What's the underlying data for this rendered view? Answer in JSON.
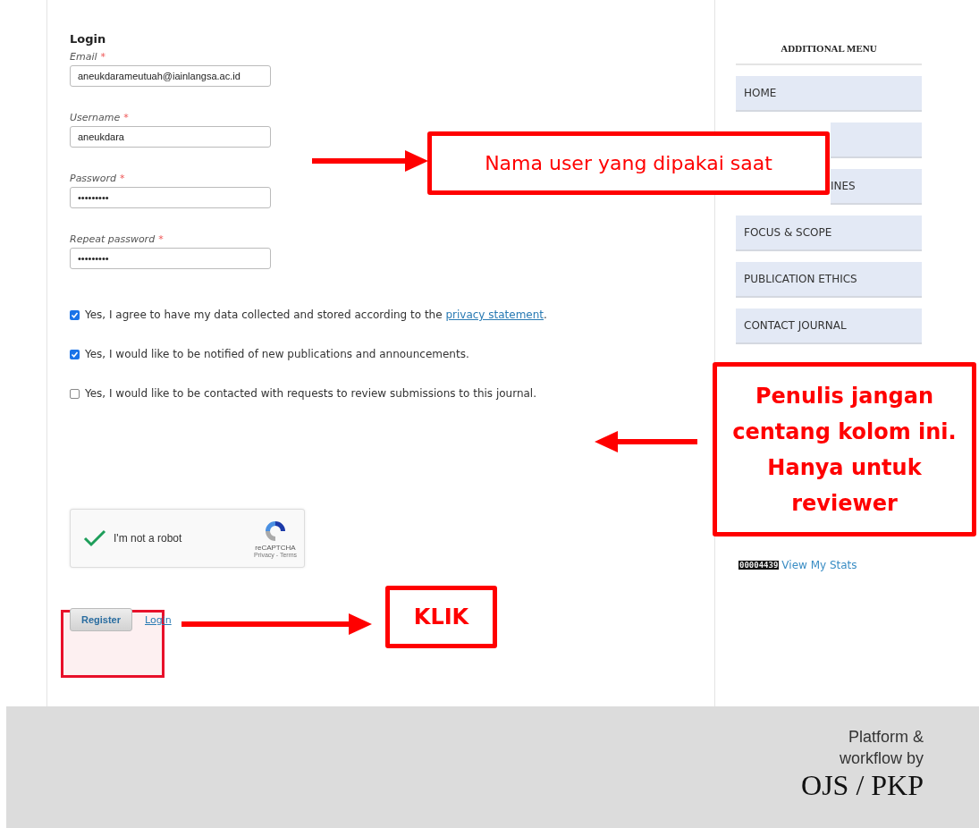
{
  "form": {
    "title": "Login",
    "fields": [
      {
        "label": "Email",
        "mark": "*",
        "value": "aneukdarameutuah@iainlangsa.ac.id"
      },
      {
        "label": "Username",
        "mark": "*",
        "value": "aneukdara"
      },
      {
        "label": "Password",
        "mark": "*",
        "value": "•••••••••"
      },
      {
        "label": "Repeat password",
        "mark": "*",
        "value": "•••••••••"
      }
    ],
    "consents": [
      {
        "text": "Yes, I agree to have my data collected and stored according to the ",
        "link": "privacy statement",
        "after": ".",
        "checked": true
      },
      {
        "text": "Yes, I would like to be notified of new publications and announcements.",
        "checked": true
      },
      {
        "text": "Yes, I would like to be contacted with requests to review submissions to this journal.",
        "checked": false
      }
    ],
    "captcha": {
      "label": "I'm not a robot",
      "checked": true,
      "brand": "reCAPTCHA",
      "links": "Privacy - Terms"
    },
    "register_button": "Register",
    "login_link": "Login"
  },
  "sidebar": {
    "title": "ADDITIONAL MENU",
    "items": [
      {
        "label": "HOME",
        "covered": false
      },
      {
        "covered": true
      },
      {
        "label": "INES",
        "covered": true
      },
      {
        "label": "FOCUS & SCOPE",
        "covered": false
      },
      {
        "label": "PUBLICATION ETHICS",
        "covered": false
      },
      {
        "label": "CONTACT JOURNAL",
        "covered": false
      }
    ],
    "counter": "00004439",
    "stats_link": "View My Stats"
  },
  "footer": {
    "lines": [
      "Platform &",
      "workflow by"
    ],
    "logo": "OJS / PKP"
  },
  "annotations": [
    {
      "kind": "note",
      "lines": [
        "Nama user yang dipakai saat"
      ],
      "bold": false
    },
    {
      "kind": "note",
      "lines": [
        "Penulis jangan",
        "centang kolom ini.",
        "Hanya untuk",
        "reviewer"
      ],
      "bold": true
    },
    {
      "kind": "note",
      "lines": [
        "KLIK"
      ],
      "bold": true
    },
    {
      "kind": "highlight"
    }
  ]
}
